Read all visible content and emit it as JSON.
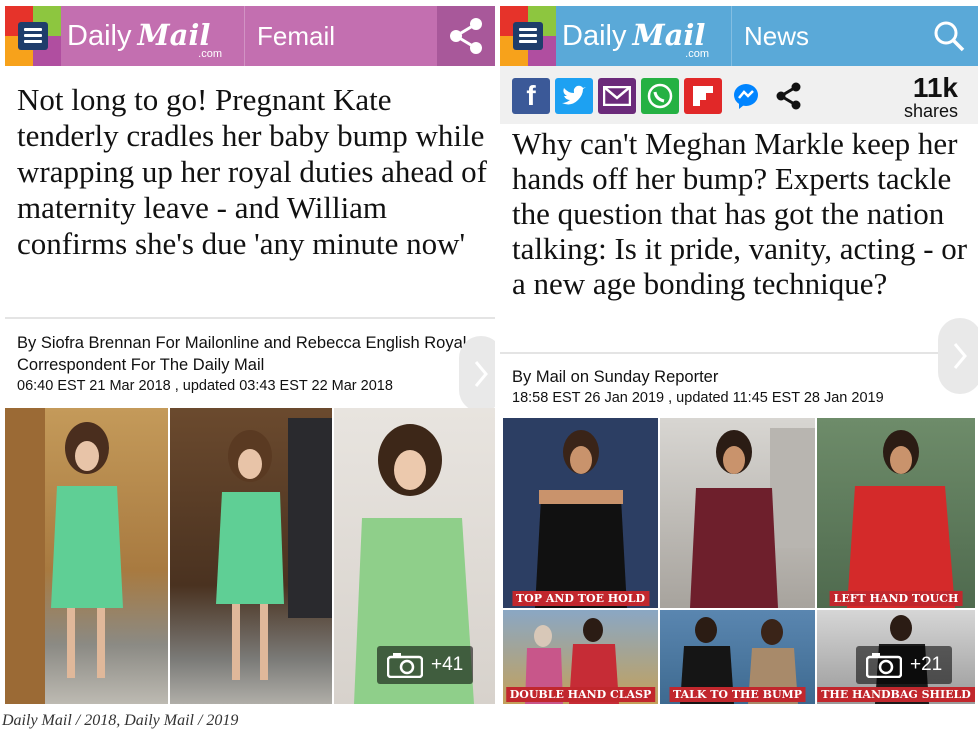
{
  "left": {
    "logo": {
      "daily": "Daily",
      "mail": "Mail",
      "com": ".com"
    },
    "section": "Femail",
    "headline": "Not long to go! Pregnant Kate tenderly cradles her baby bump while wrapping up her royal duties ahead of maternity leave - and William confirms she's due 'any minute now'",
    "byline": "By Siofra Brennan For Mailonline and Rebecca English Royal Correspondent For The Daily Mail",
    "dates": "06:40 EST 21 Mar 2018 , updated 03:43 EST 22 Mar 2018",
    "gallery_count": "+41"
  },
  "right": {
    "logo": {
      "daily": "Daily",
      "mail": "Mail",
      "com": ".com"
    },
    "section": "News",
    "share_count": "11k",
    "share_label": "shares",
    "headline": "Why can't Meghan Markle keep her hands off her bump? Experts tackle the question that has got the nation talking: Is it pride, vanity, acting - or a new age bonding technique?",
    "byline": "By Mail on Sunday Reporter",
    "dates": "18:58 EST 26 Jan 2019 , updated 11:45 EST 28 Jan 2019",
    "captions": [
      "TOP AND TOE HOLD",
      "LEFT HAND TOUCH",
      "DOUBLE HAND CLASP",
      "TALK TO THE BUMP",
      "THE HANDBAG SHIELD"
    ],
    "gallery_count": "+21"
  },
  "credit": "Daily Mail / 2018, Daily Mail / 2019",
  "colors": {
    "femail_header": "#c36fb0",
    "news_header": "#5aa9d8",
    "facebook": "#3b5998",
    "twitter": "#1da1f2",
    "email": "#6b2a7a",
    "whatsapp": "#25b143",
    "flipboard": "#e12828",
    "messenger": "#0084ff",
    "caption_red": "#c1272d"
  },
  "icons": [
    "menu-icon",
    "share-icon",
    "search-icon",
    "facebook-icon",
    "twitter-icon",
    "email-icon",
    "whatsapp-icon",
    "flipboard-icon",
    "messenger-icon",
    "camera-icon",
    "chevron-right-icon"
  ]
}
